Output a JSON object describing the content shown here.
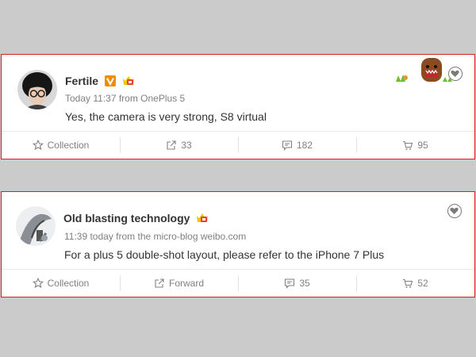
{
  "posts": [
    {
      "username": "Fertile",
      "meta": "Today 11:37 from OnePlus 5",
      "content": "Yes, the camera is very strong, S8 virtual",
      "badges": [
        "v-verified-icon",
        "vip-crown-icon"
      ],
      "actions": [
        {
          "icon": "star-icon",
          "label": "Collection"
        },
        {
          "icon": "share-icon",
          "label": "33"
        },
        {
          "icon": "comment-icon",
          "label": "182"
        },
        {
          "icon": "like-icon",
          "label": "95"
        }
      ]
    },
    {
      "username": "Old blasting technology",
      "meta": "11:39 today from the micro-blog weibo.com",
      "content": "For a plus 5 double-shot layout, please refer to the iPhone 7 Plus",
      "badges": [
        "vip-crown-icon"
      ],
      "actions": [
        {
          "icon": "star-icon",
          "label": "Collection"
        },
        {
          "icon": "share-icon",
          "label": "Forward"
        },
        {
          "icon": "comment-icon",
          "label": "35"
        },
        {
          "icon": "like-icon",
          "label": "52"
        }
      ]
    }
  ],
  "colors": {
    "background": "#cbcbcb",
    "card_border": "#d41f2a",
    "text": "#333333",
    "muted": "#808080",
    "verified_orange": "#f38b00"
  }
}
